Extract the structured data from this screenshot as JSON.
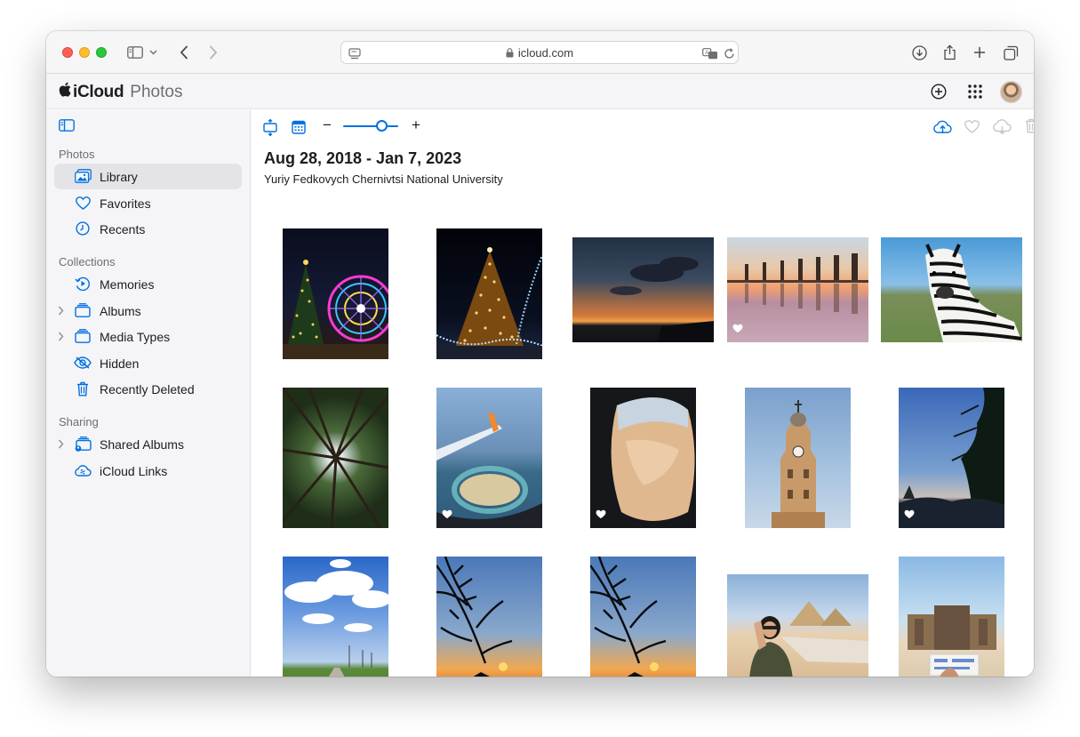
{
  "browser": {
    "url": "icloud.com",
    "icons": [
      "sidebar-icon",
      "chevron-down-icon",
      "back-icon",
      "forward-icon",
      "page-icon",
      "translate-icon",
      "reload-icon",
      "download-icon",
      "share-icon",
      "new-tab-icon",
      "tabs-overview-icon"
    ]
  },
  "header": {
    "brand": "iCloud",
    "app": "Photos",
    "icons": [
      "add-icon",
      "app-grid-icon",
      "avatar"
    ]
  },
  "sidebar": {
    "sections": [
      {
        "title": "Photos",
        "items": [
          {
            "label": "Library",
            "icon": "library-icon",
            "active": true
          },
          {
            "label": "Favorites",
            "icon": "heart-icon"
          },
          {
            "label": "Recents",
            "icon": "clock-icon"
          }
        ]
      },
      {
        "title": "Collections",
        "items": [
          {
            "label": "Memories",
            "icon": "memories-icon"
          },
          {
            "label": "Albums",
            "icon": "albums-icon",
            "expandable": true
          },
          {
            "label": "Media Types",
            "icon": "media-types-icon",
            "expandable": true
          },
          {
            "label": "Hidden",
            "icon": "eye-slash-icon"
          },
          {
            "label": "Recently Deleted",
            "icon": "trash-icon"
          }
        ]
      },
      {
        "title": "Sharing",
        "items": [
          {
            "label": "Shared Albums",
            "icon": "shared-albums-icon",
            "expandable": true
          },
          {
            "label": "iCloud Links",
            "icon": "icloud-link-icon"
          }
        ]
      }
    ]
  },
  "main": {
    "date_range": "Aug 28, 2018 - Jan 7, 2023",
    "location": "Yuriy Fedkovych Chernivtsi National University",
    "zoom": {
      "minus": "−",
      "plus": "+",
      "level": 0.7
    },
    "toolbar_icons": [
      "upload-icon",
      "favorite-icon",
      "download-icon",
      "delete-icon",
      "more-icon"
    ],
    "photos": [
      {
        "subject": "ferris-wheel-night",
        "favorite": false
      },
      {
        "subject": "christmas-tree-night",
        "favorite": false
      },
      {
        "subject": "sunset-clouds",
        "favorite": false
      },
      {
        "subject": "pier-reflection",
        "favorite": true
      },
      {
        "subject": "zebra",
        "favorite": false
      },
      {
        "subject": "forest-canopy",
        "favorite": false
      },
      {
        "subject": "airplane-wing-coast",
        "favorite": true
      },
      {
        "subject": "airplane-window-desert",
        "favorite": true
      },
      {
        "subject": "church-tower",
        "favorite": false
      },
      {
        "subject": "pine-tree-dusk",
        "favorite": true
      },
      {
        "subject": "country-road-clouds",
        "favorite": false
      },
      {
        "subject": "pine-sunset",
        "favorite": false
      },
      {
        "subject": "pine-sunset-2",
        "favorite": false
      },
      {
        "subject": "pyramids-portrait",
        "favorite": false
      },
      {
        "subject": "temple-ticket",
        "favorite": false
      }
    ]
  }
}
